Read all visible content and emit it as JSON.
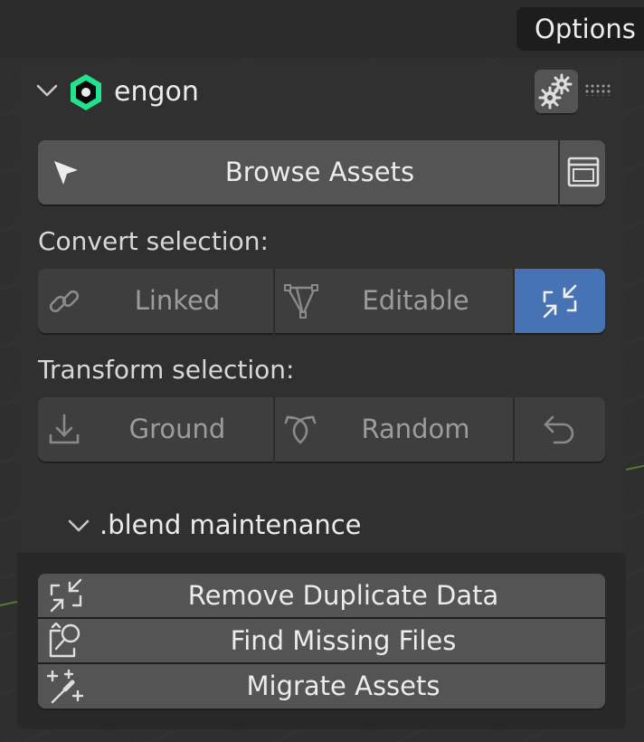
{
  "header": {
    "options_label": "Options"
  },
  "panel": {
    "title": "engon",
    "browse": {
      "label": "Browse Assets"
    },
    "convert": {
      "heading": "Convert selection:",
      "linked_label": "Linked",
      "editable_label": "Editable"
    },
    "transform": {
      "heading": "Transform selection:",
      "ground_label": "Ground",
      "random_label": "Random"
    },
    "maintenance": {
      "heading": ".blend maintenance",
      "remove_duplicates_label": "Remove Duplicate Data",
      "find_missing_label": "Find Missing Files",
      "migrate_label": "Migrate Assets"
    }
  },
  "colors": {
    "accent": "#4772b3",
    "logo_green": "#21e38e",
    "button": "#545454",
    "panel": "#303030"
  },
  "icons": [
    "chevron-down-icon",
    "engon-logo-icon",
    "gear-icon",
    "cursor-icon",
    "window-icon",
    "link-icon",
    "mesh-icon",
    "shrink-arrows-icon",
    "ground-icon",
    "random-icon",
    "undo-icon",
    "find-missing-icon",
    "magic-wand-icon"
  ]
}
